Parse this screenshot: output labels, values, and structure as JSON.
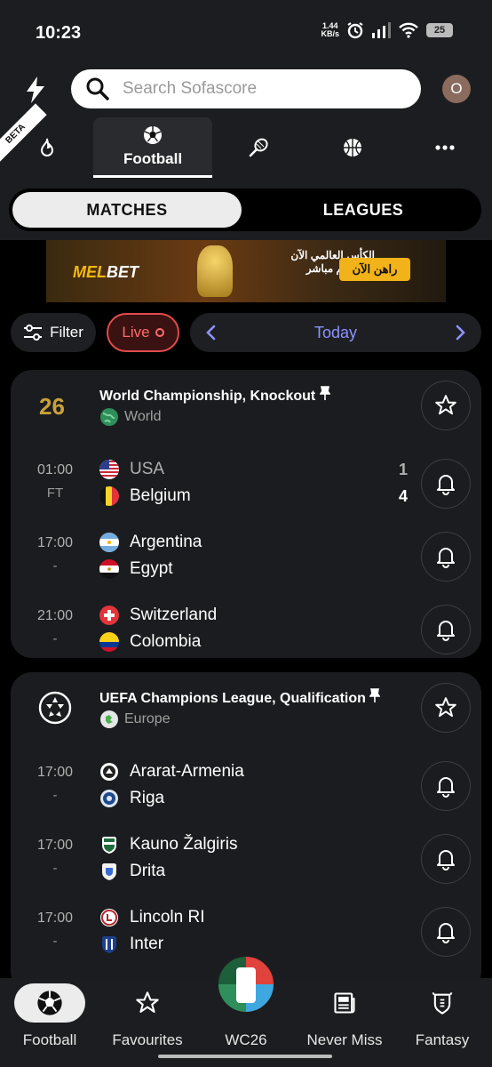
{
  "status_bar": {
    "time": "10:23",
    "net_speed_value": "1.44",
    "net_speed_unit": "KB/s",
    "battery": "25"
  },
  "header": {
    "search_placeholder": "Search Sofascore",
    "avatar_initial": "O",
    "beta_label": "BETA"
  },
  "sport_tabs": {
    "active_label": "Football"
  },
  "segment": {
    "matches": "MATCHES",
    "leagues": "LEAGUES"
  },
  "banner": {
    "brand_a": "MEL",
    "brand_b": "BET",
    "headline": "الكأس العالمي الآن في قسم مباشر",
    "cta": "راهن الآن"
  },
  "controls": {
    "filter": "Filter",
    "live": "Live",
    "date": "Today"
  },
  "leagues": [
    {
      "name": "World Championship, Knockout",
      "region": "World",
      "matches": [
        {
          "time": "01:00",
          "status": "FT",
          "home": "USA",
          "away": "Belgium",
          "home_score": "1",
          "away_score": "4"
        },
        {
          "time": "17:00",
          "status": "-",
          "home": "Argentina",
          "away": "Egypt"
        },
        {
          "time": "21:00",
          "status": "-",
          "home": "Switzerland",
          "away": "Colombia"
        }
      ]
    },
    {
      "name": "UEFA Champions League, Qualification",
      "region": "Europe",
      "matches": [
        {
          "time": "17:00",
          "status": "-",
          "home": "Ararat-Armenia",
          "away": "Riga"
        },
        {
          "time": "17:00",
          "status": "-",
          "home": "Kauno Žalgiris",
          "away": "Drita"
        },
        {
          "time": "17:00",
          "status": "-",
          "home": "Lincoln RI",
          "away": "Inter"
        }
      ]
    }
  ],
  "bottom_nav": {
    "football": "Football",
    "favourites": "Favourites",
    "wc26": "WC26",
    "never_miss": "Never Miss",
    "fantasy": "Fantasy"
  },
  "colors": {
    "accent": "#8c93ff",
    "live": "#e24b4b",
    "background": "#000000",
    "card": "#1b1c1f"
  }
}
